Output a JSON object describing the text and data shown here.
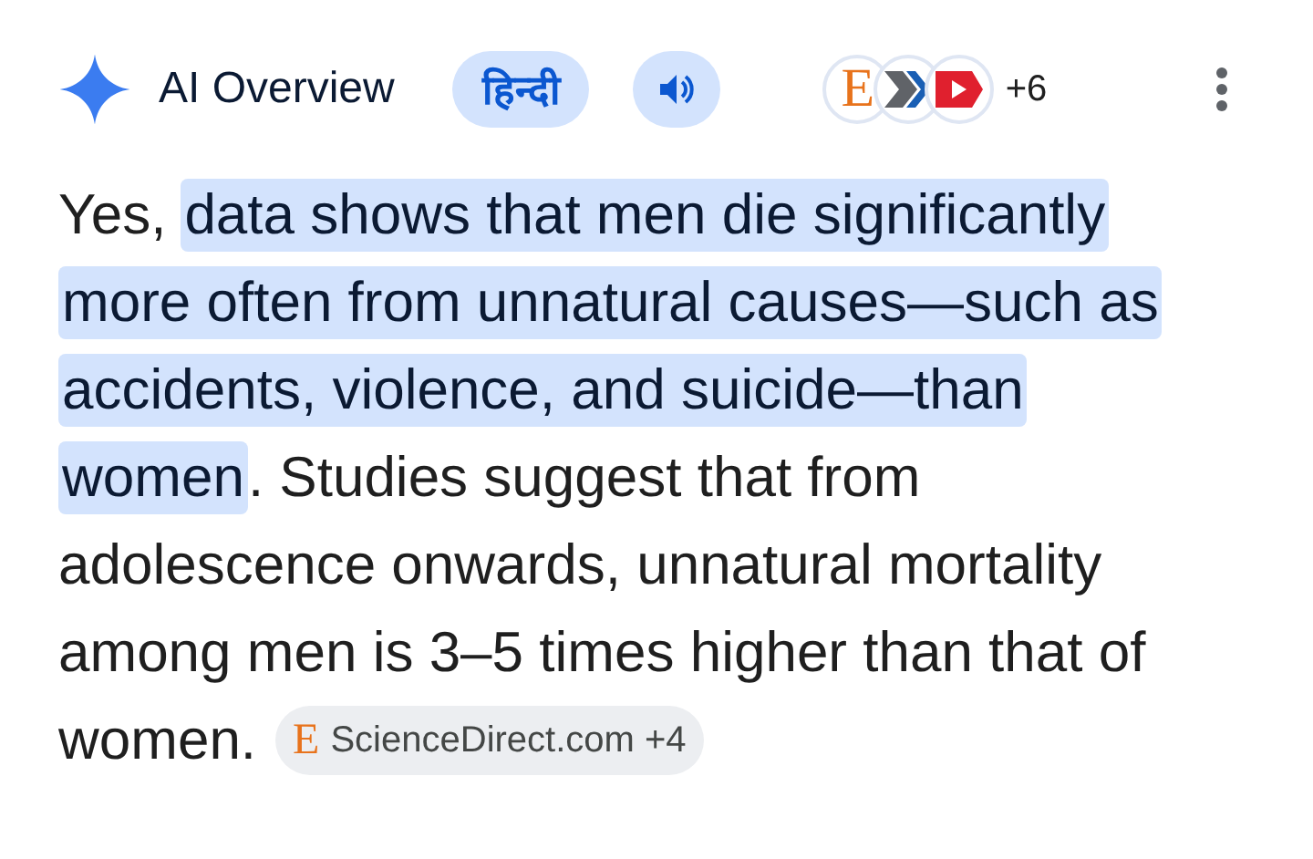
{
  "header": {
    "title": "AI Overview",
    "language_button": "हिन्दी",
    "sources": [
      {
        "kind": "letter",
        "letter": "E"
      },
      {
        "kind": "chevrons"
      },
      {
        "kind": "play"
      }
    ],
    "sources_more": "+6"
  },
  "answer": {
    "lines": [
      [
        {
          "text": "Yes,",
          "highlighted": false
        },
        {
          "text": "data shows that men die significantly",
          "highlighted": true
        }
      ],
      [
        {
          "text": "more often from unnatural causes—such as",
          "highlighted": true
        }
      ],
      [
        {
          "text": "accidents, violence, and suicide—than",
          "highlighted": true
        }
      ],
      [
        {
          "text": "women",
          "highlighted": true
        },
        {
          "text": ". Studies suggest that from",
          "highlighted": false
        }
      ],
      [
        {
          "text": "adolescence onwards, unnatural mortality",
          "highlighted": false
        }
      ],
      [
        {
          "text": "among men is 3–5 times higher than that of",
          "highlighted": false
        }
      ],
      [
        {
          "text": "women.",
          "highlighted": false
        }
      ]
    ],
    "citation": {
      "letter": "E",
      "label": "ScienceDirect.com +4"
    }
  }
}
